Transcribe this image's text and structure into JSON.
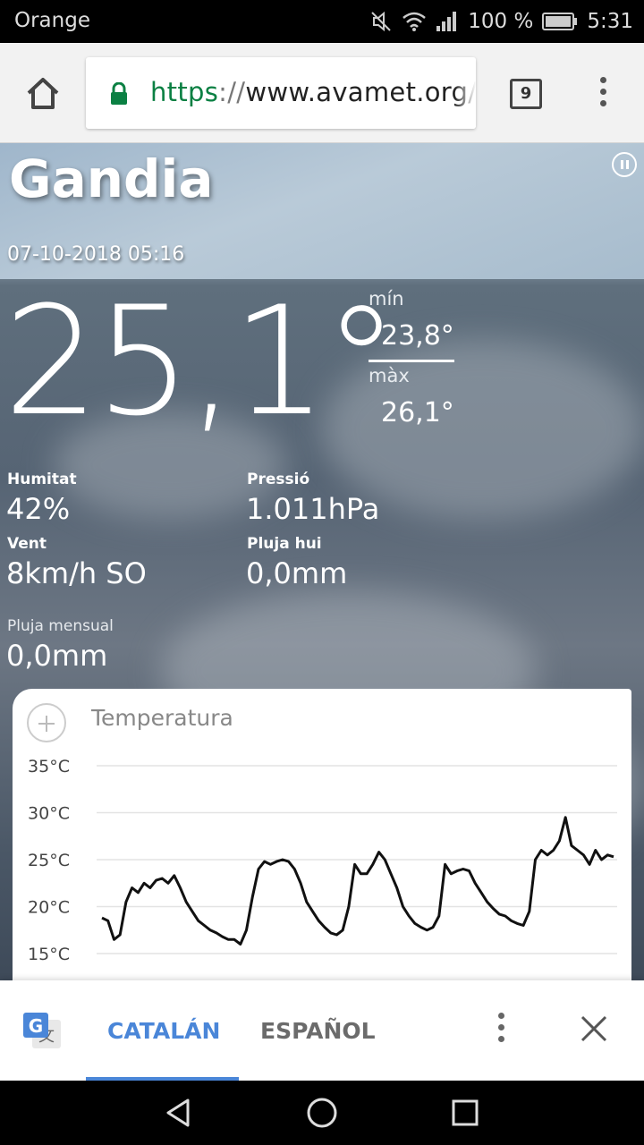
{
  "status_bar": {
    "carrier": "Orange",
    "battery": "100 %",
    "time": "5:31"
  },
  "browser": {
    "url_scheme": "https",
    "url_sep": "://",
    "url_host": "www.avamet.org/",
    "tab_count": "9"
  },
  "station": {
    "city": "Gandia",
    "datetime": "07-10-2018 05:16",
    "temperature": "25,1°",
    "min_label": "mín",
    "min_value": "23,8°",
    "max_label": "màx",
    "max_value": "26,1°"
  },
  "stats": {
    "humidity_label": "Humitat",
    "humidity_value": "42%",
    "pressure_label": "Pressió",
    "pressure_value": "1.011hPa",
    "wind_label": "Vent",
    "wind_value": "8km/h SO",
    "rain_today_label": "Pluja hui",
    "rain_today_value": "0,0mm",
    "rain_month_label": "Pluja mensual",
    "rain_month_value": "0,0mm"
  },
  "chart_card": {
    "title": "Temperatura"
  },
  "chart_data": {
    "type": "line",
    "title": "Temperatura",
    "xlabel": "",
    "ylabel": "",
    "y_tick_labels": [
      "35°C",
      "30°C",
      "25°C",
      "20°C",
      "15°C"
    ],
    "y_ticks": [
      35,
      30,
      25,
      20,
      15
    ],
    "ylim": [
      14,
      36
    ],
    "grid": true,
    "series": [
      {
        "values": [
          18.8,
          18.5,
          16.5,
          17.0,
          20.5,
          22.0,
          21.5,
          22.5,
          22.0,
          22.8,
          23.0,
          22.5,
          23.3,
          22.0,
          20.5,
          19.5,
          18.5,
          18.0,
          17.5,
          17.2,
          16.8,
          16.5,
          16.5,
          16.0,
          17.5,
          21.0,
          24.0,
          24.8,
          24.5,
          24.8,
          25.0,
          24.8,
          24.0,
          22.5,
          20.5,
          19.5,
          18.5,
          17.8,
          17.2,
          17.0,
          17.5,
          20.0,
          24.5,
          23.5,
          23.5,
          24.5,
          25.8,
          25.0,
          23.5,
          22.0,
          20.0,
          19.0,
          18.2,
          17.8,
          17.5,
          17.8,
          19.0,
          24.5,
          23.5,
          23.8,
          24.0,
          23.8,
          22.5,
          21.5,
          20.5,
          19.8,
          19.2,
          19.0,
          18.5,
          18.2,
          18.0,
          19.5,
          25.0,
          26.0,
          25.5,
          26.0,
          27.0,
          29.5,
          26.5,
          26.0,
          25.5,
          24.5,
          26.0,
          25.0,
          25.5,
          25.3
        ]
      }
    ]
  },
  "translate_bar": {
    "lang_source": "CATALÁN",
    "lang_target": "ESPAÑOL"
  }
}
